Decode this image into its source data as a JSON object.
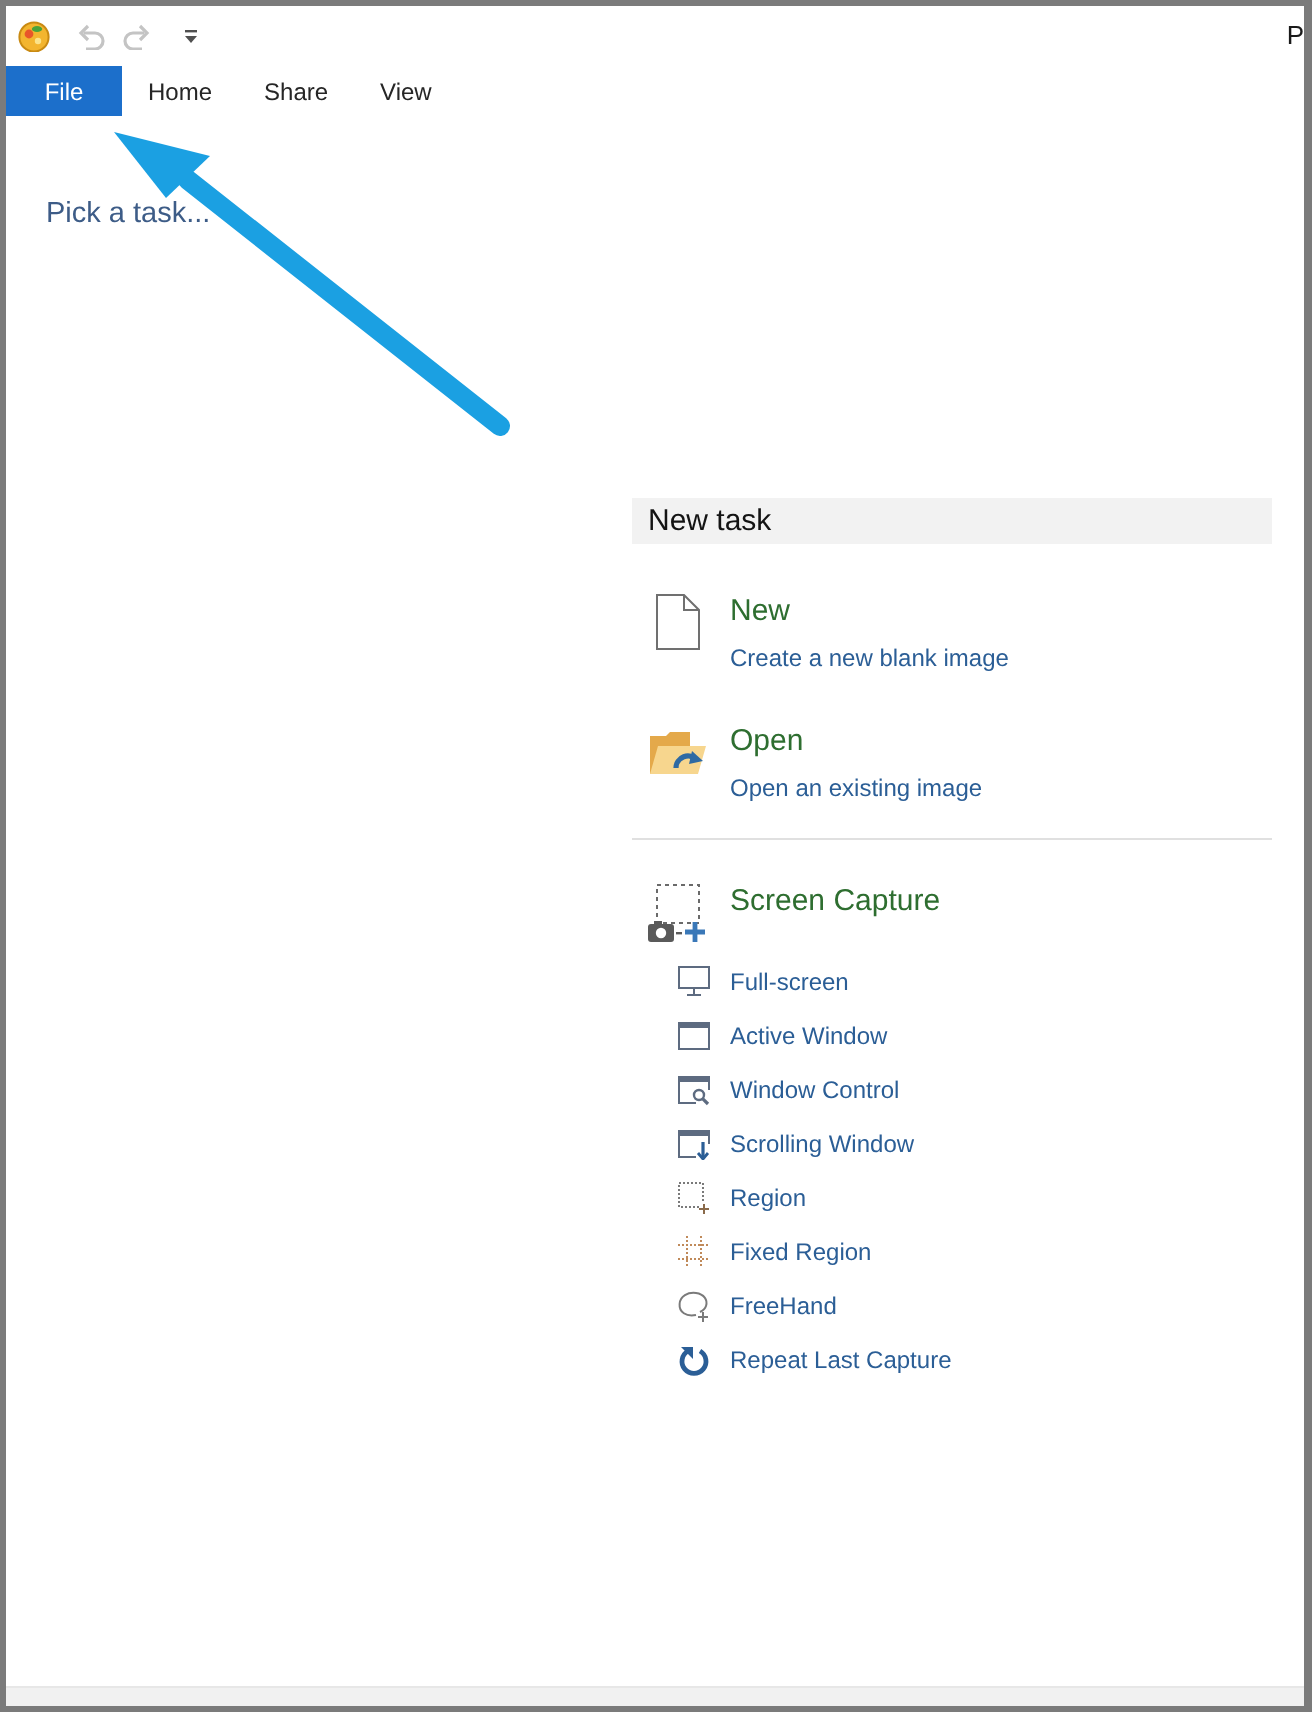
{
  "window": {
    "title": "P"
  },
  "quick_access_toolbar": [
    {
      "kind": "undo",
      "disabled": true
    },
    {
      "kind": "redo",
      "disabled": true
    },
    {
      "kind": "customize"
    }
  ],
  "tabs": [
    {
      "label": "File",
      "selected": true
    },
    {
      "label": "Home",
      "selected": false
    },
    {
      "label": "Share",
      "selected": false
    },
    {
      "label": "View",
      "selected": false
    }
  ],
  "prompt": "Pick a task...",
  "task_panel": {
    "title": "New task",
    "tasks": [
      {
        "kind": "new",
        "title": "New",
        "description": "Create a new blank image"
      },
      {
        "kind": "open",
        "title": "Open",
        "description": "Open an existing image"
      }
    ],
    "capture": {
      "title": "Screen Capture",
      "options": [
        {
          "kind": "full-screen",
          "label": "Full-screen"
        },
        {
          "kind": "active-window",
          "label": "Active Window"
        },
        {
          "kind": "window-control",
          "label": "Window Control"
        },
        {
          "kind": "scrolling-window",
          "label": "Scrolling Window"
        },
        {
          "kind": "region",
          "label": "Region"
        },
        {
          "kind": "fixed-region",
          "label": "Fixed Region"
        },
        {
          "kind": "freehand",
          "label": "FreeHand"
        },
        {
          "kind": "repeat",
          "label": "Repeat Last Capture"
        }
      ]
    }
  }
}
